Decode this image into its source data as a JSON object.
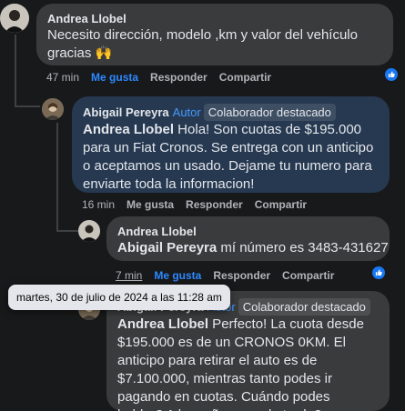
{
  "comments": [
    {
      "author": "Andrea Llobel",
      "text": "Necesito dirección, modelo ,km y valor del vehículo gracias 🙌",
      "time": "47 min",
      "like": "Me gusta",
      "reply": "Responder",
      "share": "Compartir"
    },
    {
      "author": "Abigail Pereyra",
      "author_badge": "Autor",
      "top_badge": "Colaborador destacado",
      "mention": "Andrea Llobel",
      "text": " Hola! Son cuotas de $195.000 para un Fiat Cronos. Se entrega con un anticipo o aceptamos un usado. Dejame tu numero para enviarte toda la informacion!",
      "time": "16 min",
      "like": "Me gusta",
      "reply": "Responder",
      "share": "Compartir"
    },
    {
      "author": "Andrea Llobel",
      "mention": "Abigail Pereyra",
      "text": " mí número es 3483-431627",
      "time": "7 min",
      "like": "Me gusta",
      "reply": "Responder",
      "share": "Compartir"
    },
    {
      "author": "Abigail Pereyra",
      "author_badge": "Autor",
      "top_badge": "Colaborador destacado",
      "mention": "Andrea Llobel",
      "text": " Perfecto! La cuota desde $195.000 es de un CRONOS 0KM. El anticipo para retirar el auto es de $7.100.000, mientras tanto podes ir pagando en cuotas. Cuándo podes hablar? A la mañana o a la tarde?"
    }
  ],
  "tooltip": "martes, 30 de julio de 2024 a las 11:28 am",
  "colors": {
    "accent": "#2d88ff",
    "bubble": "#3a3b3c",
    "highlight_bubble": "#263951",
    "background": "#18191a"
  }
}
